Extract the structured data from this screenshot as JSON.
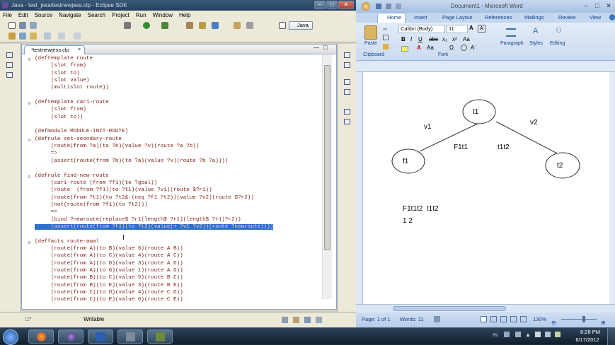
{
  "eclipse": {
    "title": "Java - test_jess/testnewjess.clp - Eclipse SDK",
    "menu": [
      "File",
      "Edit",
      "Source",
      "Navigate",
      "Search",
      "Project",
      "Run",
      "Window",
      "Help"
    ],
    "perspective": "Java",
    "tab": "*testnewjess.clp",
    "code": [
      {
        "fold": "⊖",
        "text": "(deftemplate route"
      },
      {
        "text": "     (slot from)"
      },
      {
        "text": "     (slot to)"
      },
      {
        "text": "     (slot value)"
      },
      {
        "text": "     (multislot route))"
      },
      {
        "text": ""
      },
      {
        "fold": "⊖",
        "text": "(deftemplate cari-route"
      },
      {
        "text": "     (slot from)"
      },
      {
        "text": "     (slot to))"
      },
      {
        "text": ""
      },
      {
        "text": "(defmodule MODULE-INIT-ROUTE)"
      },
      {
        "fold": "⊖",
        "text": "(defrule set-seondary-route"
      },
      {
        "text": "     (route(from ?a)(to ?b)(value ?v)(route ?a ?b))"
      },
      {
        "text": "     =>"
      },
      {
        "text": "     (assert(route(from ?b)(to ?a)(value ?v)(route ?b ?a))))"
      },
      {
        "text": ""
      },
      {
        "fold": "⊖",
        "text": "(defrule find-new-route"
      },
      {
        "text": "     (cari-route (from ?f1)(to ?goal))"
      },
      {
        "text": "     (route  (from ?f1)(to ?t1)(value ?v1)(route $?r1))"
      },
      {
        "text": "     (route(from ?t1)(to ?t2&:(neq ?f1 ?t2))(value ?v2)(route $?r2))"
      },
      {
        "text": "     (not(route(from ?f1)(to ?t2)))"
      },
      {
        "text": "     =>"
      },
      {
        "text": "     (bind ?newroute(replace$ ?r1(length$ ?r1)(length$ ?r1)?r2))"
      },
      {
        "hl": true,
        "text": "     (assert(route(from ?f1)(to ?t2)(value(+ ?v1 ?v2))(route ?newroute))))"
      },
      {
        "text": ""
      },
      {
        "fold": "⊖",
        "text": "(deffacts route-awal"
      },
      {
        "text": "     (route(from A)(to B)(value 6)(route A B))"
      },
      {
        "text": "     (route(from A)(to C)(value 4)(route A C))"
      },
      {
        "text": "     (route(from A)(to D)(value 3)(route A D))"
      },
      {
        "text": "     (route(from A)(to G)(value 1)(route A G))"
      },
      {
        "text": "     (route(from B)(to C)(value 5)(route B C))"
      },
      {
        "text": "     (route(from B)(to E)(value 3)(route B E))"
      },
      {
        "text": "     (route(from C)(to D)(value 4)(route C D))"
      },
      {
        "text": "     (route(from C)(to E)(value 6)(route C E))"
      }
    ],
    "status": {
      "mode": "Writable"
    }
  },
  "word": {
    "title": "Document1 - Microsoft Word",
    "tabs": [
      "Home",
      "Insert",
      "Page Layout",
      "References",
      "Mailings",
      "Review",
      "View"
    ],
    "font": "Calibri (Body)",
    "size": "11",
    "groups": {
      "clipboard": "Clipboard",
      "font": "Font",
      "paragraph": "Paragraph",
      "styles": "Styles",
      "editing": "Editing",
      "paste": "Paste"
    },
    "diagram": {
      "n_t1": "t1",
      "n_f1": "f1",
      "n_t2": "t2",
      "e_v1": "v1",
      "e_v2": "v2",
      "lbl_f1t1": "F1t1",
      "lbl_t1t2": "t1t2"
    },
    "text_line1": "F1t1t2  t1t2",
    "text_line2": "1 2",
    "status": {
      "page": "Page: 1 of 1",
      "words": "Words: 11",
      "zoom": "130%"
    }
  },
  "taskbar": {
    "time": "8:28 PM",
    "date": "6/17/2012"
  }
}
